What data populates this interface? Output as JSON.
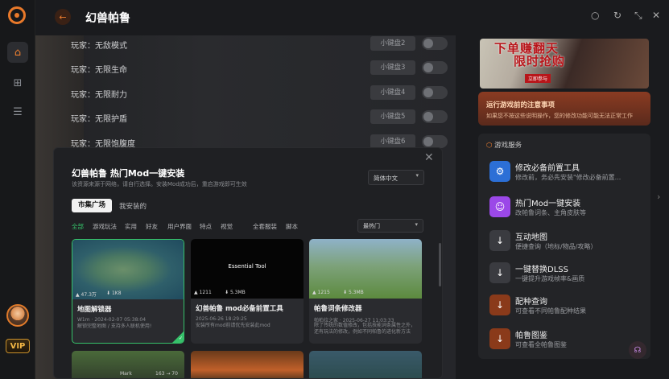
{
  "app": {
    "title": "幻兽帕鲁"
  },
  "window_controls": [
    "circle-icon",
    "refresh-icon",
    "minimize-icon",
    "close-icon"
  ],
  "rows": [
    {
      "label": "玩家：无敌模式",
      "key": "小键盘2"
    },
    {
      "label": "玩家：无限生命",
      "key": "小键盘3"
    },
    {
      "label": "玩家：无限耐力",
      "key": "小键盘4"
    },
    {
      "label": "玩家：无限护盾",
      "key": "小键盘5"
    },
    {
      "label": "玩家：无限饱腹度",
      "key": "小键盘6"
    }
  ],
  "right_panel": {
    "banner": {
      "title_line1": "下单赚翻天",
      "title_line2": "限时抢购",
      "tag": "立即参与"
    },
    "notice": {
      "title": "运行游戏前的注意事项",
      "desc": "如果您不按这些说明操作，您的修改功能可能无法正常工作"
    },
    "services_title": "游戏服务",
    "services": [
      {
        "title": "修改必备前置工具",
        "desc": "修改前，务必先安装\"修改必备前置...",
        "color": "#2c6fd6",
        "icon": "tools-icon"
      },
      {
        "title": "热门Mod一键安装",
        "desc": "改帕鲁词条、主角皮肤等",
        "color": "#9b48e8",
        "icon": "mod-icon"
      },
      {
        "title": "互动地图",
        "desc": "便捷查询（地标/物品/攻略）",
        "color": "#3a3b40",
        "icon": "map-icon"
      },
      {
        "title": "一键替换DLSS",
        "desc": "一键提升游戏帧率&画质",
        "color": "#3a3b40",
        "icon": "dlss-icon"
      },
      {
        "title": "配种查询",
        "desc": "可查看不同帕鲁配种结果",
        "color": "#8a3a1a",
        "icon": "breed-icon"
      },
      {
        "title": "帕鲁图鉴",
        "desc": "可查看全帕鲁图鉴",
        "color": "#8a3a1a",
        "icon": "book-icon"
      }
    ]
  },
  "modal": {
    "title": "幻兽帕鲁 热门Mod一键安装",
    "desc": "该资源来源于网络，请自行选择。安装Mod成功后，重启游戏即可生效",
    "language": "简体中文",
    "tabs": [
      "市集广场",
      "我安装的"
    ],
    "categories": [
      "全部",
      "游戏玩法",
      "实用",
      "好友",
      "用户界面",
      "特点",
      "视觉",
      "全套服装",
      "脚本"
    ],
    "sort": "最热门",
    "cards": [
      {
        "title": "地图解锁器",
        "likes": "47.3万",
        "dl": "1K8",
        "meta": "W1m · 2024-02-07 05:38:04",
        "desc": "解锁完整地图 / 支持多人联机使用!",
        "selected": true
      },
      {
        "title": "幻兽帕鲁 mod必备前置工具",
        "likes": "1211",
        "size": "5.3MB",
        "meta": "2025-06-26 18:29:25",
        "desc": "安装所有mod前请优先安装此mod",
        "thumb_text": "Essential Tool"
      },
      {
        "title": "帕鲁词条修改器",
        "likes": "1215",
        "size": "5.3MB",
        "meta": "帕柏拉之家 · 2025-06-27 11:03:33",
        "desc": "除了传统的数值修改，包括技能词条属性之外，还有玩法的修改，例如不同帕鲁的进化新方法"
      }
    ],
    "partial_card_text": [
      "Mark",
      "163 → 70"
    ]
  }
}
